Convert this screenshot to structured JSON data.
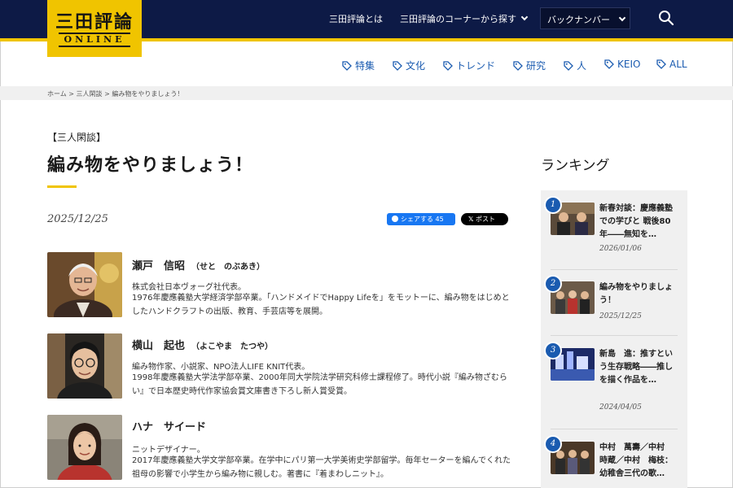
{
  "header": {
    "logo_main": "三田評論",
    "logo_sub": "ONLINE",
    "nav": {
      "about": "三田評論とは",
      "corners": "三田評論のコーナーから探す",
      "back_numbers": "バックナンバー"
    },
    "categories": [
      "特集",
      "文化",
      "トレンド",
      "研究",
      "人",
      "KEIO",
      "ALL"
    ],
    "colors": {
      "navy": "#0d1a46",
      "gold": "#f0c400",
      "link_blue": "#1a5bb0"
    }
  },
  "breadcrumb": "ホーム > 三人閑談 > 編み物をやりましょう！",
  "article": {
    "tag": "【三人閑談】",
    "title": "編み物をやりましょう！",
    "date": "2025/12/25",
    "share": {
      "facebook_label": "シェアする",
      "facebook_count": "45",
      "x_label": "ポスト"
    }
  },
  "people": [
    {
      "name": "瀬戸　信昭",
      "reading": "（せと　のぶあき）",
      "role": "株式会社日本ヴォーグ社代表。",
      "bio": "1976年慶應義塾大学経済学部卒業。「ハンドメイドでHappy Lifeを」をモットーに、編み物をはじめとしたハンドクラフトの出版、教育、手芸店等を展開。"
    },
    {
      "name": "横山　起也",
      "reading": "（よこやま　たつや）",
      "role": "編み物作家、小説家、NPO法人LIFE KNIT代表。",
      "bio": "1998年慶應義塾大学法学部卒業、2000年同大学院法学研究科修士課程修了。時代小説『編み物ざむらい』で日本歴史時代作家協会賞文庫書き下ろし新人賞受賞。"
    },
    {
      "name": "ハナ　サイード",
      "reading": "",
      "role": "ニットデザイナー。",
      "bio": "2017年慶應義塾大学文学部卒業。在学中にパリ第一大学美術史学部留学。毎年セーターを編んでくれた祖母の影響で小学生から編み物に親しむ。著書に『着まわしニット』。"
    }
  ],
  "ranking": {
    "heading": "ランキング",
    "items": [
      {
        "rank": "1",
        "title": "新春対談：慶應義塾での学びと 戦後80年――無知を…",
        "date": "2026/01/06"
      },
      {
        "rank": "2",
        "title": "編み物をやりましょう！",
        "date": "2025/12/25"
      },
      {
        "rank": "3",
        "title": "新島　進：推すという生存戦略――推しを描く作品を…",
        "date": "2024/04/05"
      },
      {
        "rank": "4",
        "title": "中村　萬壽／中村　時蔵／中村　梅枝：幼稚舎三代の歌…",
        "date": ""
      }
    ]
  }
}
